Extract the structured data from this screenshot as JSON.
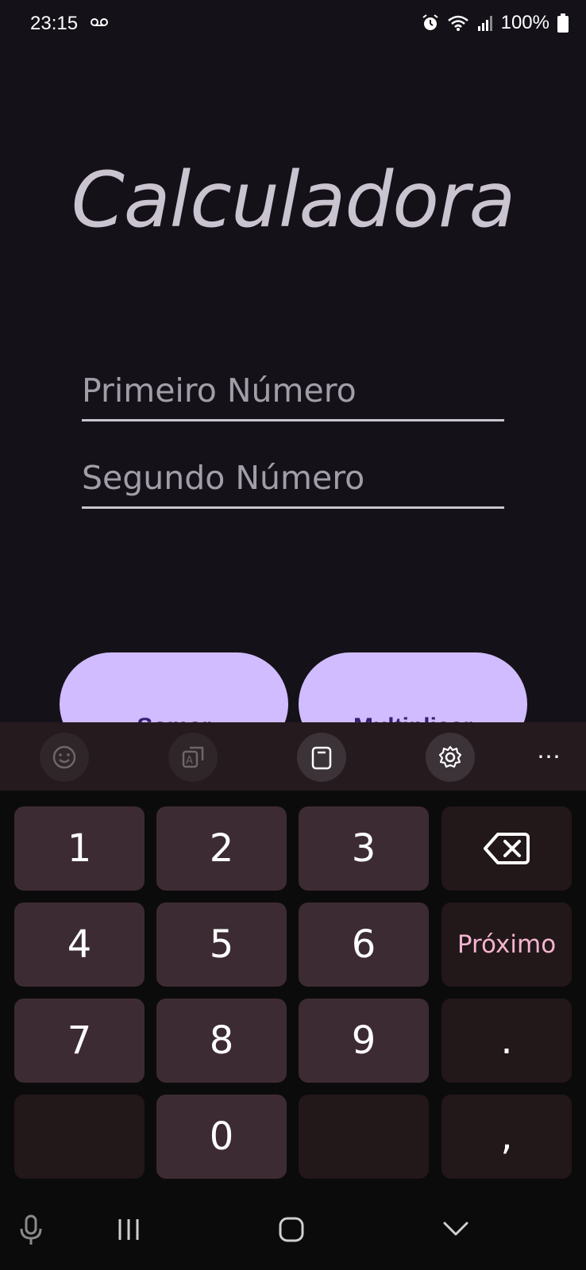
{
  "status_bar": {
    "time": "23:15",
    "battery": "100%"
  },
  "app": {
    "title": "Calculadora",
    "first_placeholder": "Primeiro Número",
    "second_placeholder": "Segundo Número",
    "add_label": "Somar",
    "multiply_label": "Multiplicar"
  },
  "keyboard": {
    "toolbar_icons": [
      "emoji-icon",
      "translate-icon",
      "clipboard-icon",
      "settings-icon",
      "more-icon"
    ],
    "more_label": "⋯",
    "keys": {
      "k1": "1",
      "k2": "2",
      "k3": "3",
      "k4": "4",
      "k5": "5",
      "k6": "6",
      "k7": "7",
      "k8": "8",
      "k9": "9",
      "k0": "0",
      "next": "Próximo",
      "dot": ".",
      "comma": ","
    }
  },
  "colors": {
    "background": "#141218",
    "title": "#cac4d0",
    "button": "#d0bcff",
    "button_text": "#381e72",
    "key": "#3d2b33",
    "key_fn": "#221719",
    "next_text": "#f3b4cf"
  }
}
